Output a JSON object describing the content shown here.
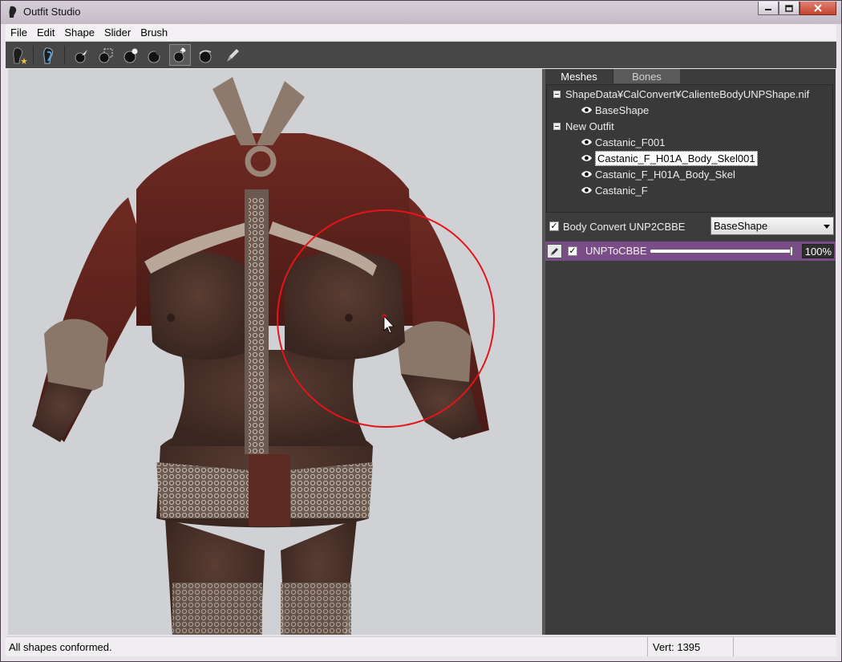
{
  "window": {
    "title": "Outfit Studio",
    "controls": [
      "minimize",
      "maximize",
      "close"
    ]
  },
  "menu": [
    "File",
    "Edit",
    "Shape",
    "Slider",
    "Brush"
  ],
  "toolbar": {
    "tools": [
      "new-project-icon",
      "load-project-icon",
      "select-brush-icon",
      "mask-brush-icon",
      "inflate-brush-icon",
      "deflate-brush-icon",
      "move-brush-icon",
      "smooth-brush-icon",
      "weight-brush-icon"
    ],
    "active_tool": "move-brush-icon"
  },
  "panel": {
    "tabs": [
      {
        "label": "Meshes",
        "active": true
      },
      {
        "label": "Bones",
        "active": false
      }
    ],
    "tree": [
      {
        "label": "ShapeData¥CalConvert¥CalienteBodyUNPShape.nif",
        "level": 0,
        "group": true
      },
      {
        "label": "BaseShape",
        "level": 1
      },
      {
        "label": "New Outfit",
        "level": 0,
        "group": true
      },
      {
        "label": "Castanic_F001",
        "level": 1
      },
      {
        "label": "Castanic_F_H01A_Body_Skel001",
        "level": 1,
        "selected": true
      },
      {
        "label": "Castanic_F_H01A_Body_Skel",
        "level": 1
      },
      {
        "label": "Castanic_F",
        "level": 1
      }
    ],
    "slider_set": {
      "checked": true,
      "label": "Body Convert UNP2CBBE",
      "reference": "BaseShape"
    },
    "sliders": [
      {
        "name": "UNPToCBBE",
        "checked": true,
        "value": 100,
        "value_text": "100%"
      }
    ]
  },
  "status": {
    "message": "All shapes conformed.",
    "vert": "Vert: 1395"
  },
  "colors": {
    "brush_circle": "#e4141b",
    "slider_row": "#7b4d86",
    "panel_bg": "#3c3c3c",
    "viewport_bg": "#cfd1d4"
  }
}
